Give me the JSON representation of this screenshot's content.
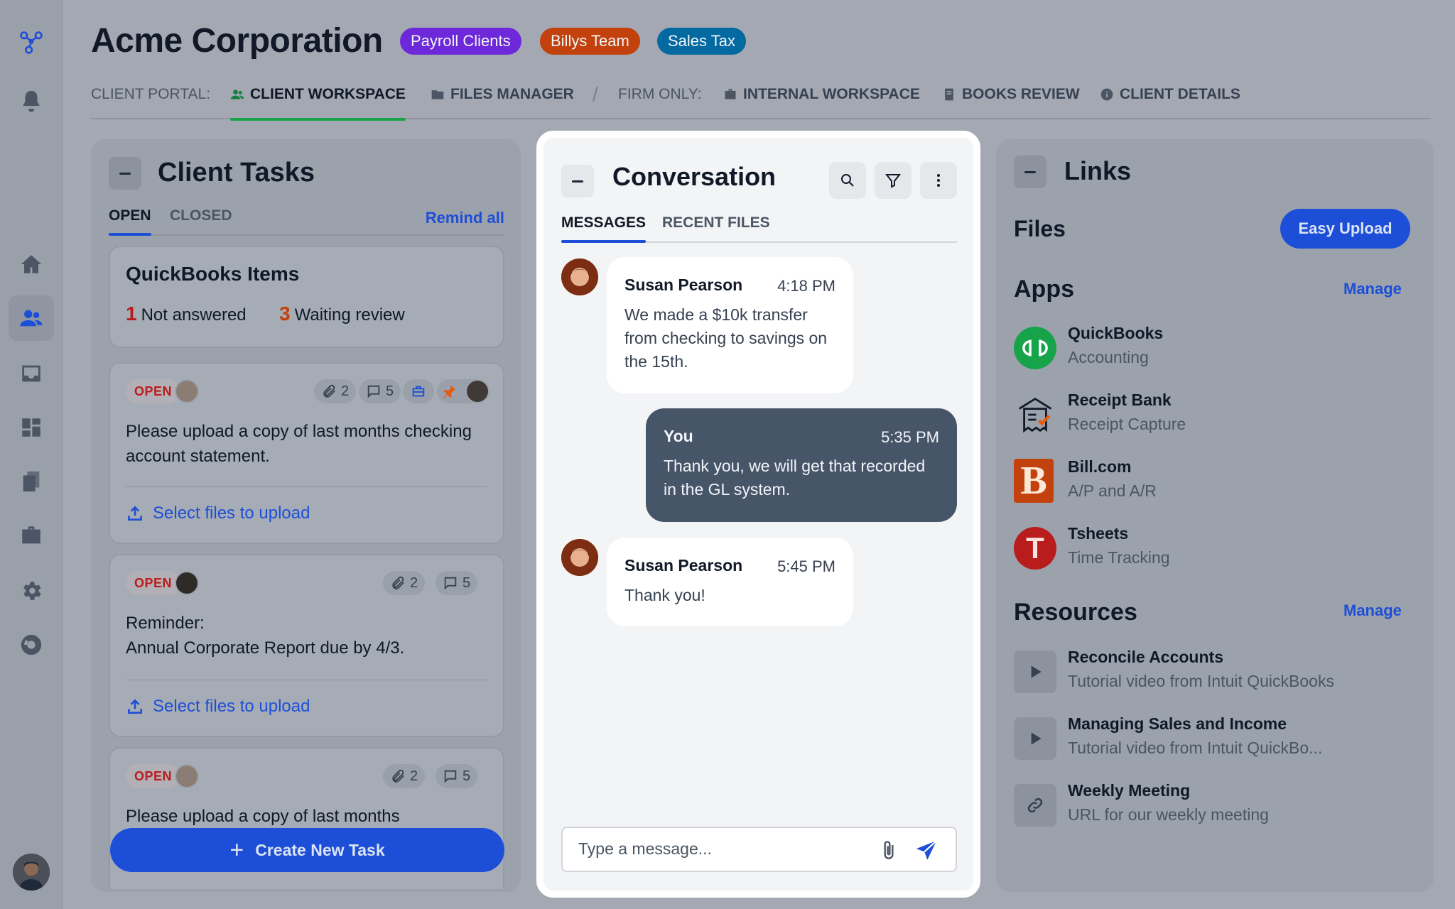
{
  "header": {
    "title": "Acme Corporation",
    "tags": [
      {
        "label": "Payroll Clients",
        "color": "#6d28d9"
      },
      {
        "label": "Billys Team",
        "color": "#c2410c"
      },
      {
        "label": "Sales Tax",
        "color": "#0369a1"
      }
    ]
  },
  "nav": {
    "client_portal_label": "CLIENT PORTAL:",
    "client_workspace": "CLIENT WORKSPACE",
    "files_manager": "FILES MANAGER",
    "separator": "/",
    "firm_only_label": "FIRM ONLY:",
    "internal_workspace": "INTERNAL WORKSPACE",
    "books_review": "BOOKS REVIEW",
    "client_details": "CLIENT DETAILS"
  },
  "tasks": {
    "title": "Client Tasks",
    "tab_open": "OPEN",
    "tab_closed": "CLOSED",
    "remind_all": "Remind all",
    "quickbooks": {
      "title": "QuickBooks Items",
      "not_answered_count": "1",
      "not_answered_label": "Not answered",
      "waiting_count": "3",
      "waiting_label": "Waiting review"
    },
    "items": [
      {
        "status": "OPEN",
        "attachments": "2",
        "comments": "5",
        "text": "Please upload a copy of last months checking account statement.",
        "upload": "Select files to upload"
      },
      {
        "status": "OPEN",
        "attachments": "2",
        "comments": "5",
        "text_line1": "Reminder:",
        "text_line2": "Annual Corporate Report due by 4/3.",
        "upload": "Select files to upload"
      },
      {
        "status": "OPEN",
        "attachments": "2",
        "comments": "5",
        "text": "Please upload a copy of last months"
      }
    ],
    "create_label": "Create New Task"
  },
  "conversation": {
    "title": "Conversation",
    "tab_messages": "MESSAGES",
    "tab_recent_files": "RECENT FILES",
    "messages": [
      {
        "who": "Susan Pearson",
        "time": "4:18 PM",
        "text": "We made a $10k transfer from checking to savings on the 15th."
      },
      {
        "who": "You",
        "time": "5:35 PM",
        "text": "Thank you, we will get that recorded in the GL system."
      },
      {
        "who": "Susan Pearson",
        "time": "5:45 PM",
        "text": "Thank you!"
      }
    ],
    "compose_placeholder": "Type a message..."
  },
  "links": {
    "title": "Links",
    "files_heading": "Files",
    "easy_upload": "Easy Upload",
    "apps_heading": "Apps",
    "manage": "Manage",
    "apps": [
      {
        "name": "QuickBooks",
        "sub": "Accounting",
        "color": "#16a34a"
      },
      {
        "name": "Receipt Bank",
        "sub": "Receipt Capture",
        "color": "#111827"
      },
      {
        "name": "Bill.com",
        "sub": "A/P and A/R",
        "color": "#c2410c"
      },
      {
        "name": "Tsheets",
        "sub": "Time Tracking",
        "color": "#b91c1c"
      }
    ],
    "resources_heading": "Resources",
    "resources": [
      {
        "name": "Reconcile Accounts",
        "sub": "Tutorial video from Intuit QuickBooks",
        "icon": "play-icon"
      },
      {
        "name": "Managing Sales and Income",
        "sub": "Tutorial video from Intuit QuickBo...",
        "icon": "play-icon"
      },
      {
        "name": "Weekly Meeting",
        "sub": "URL for our weekly meeting",
        "icon": "link-icon"
      }
    ]
  }
}
